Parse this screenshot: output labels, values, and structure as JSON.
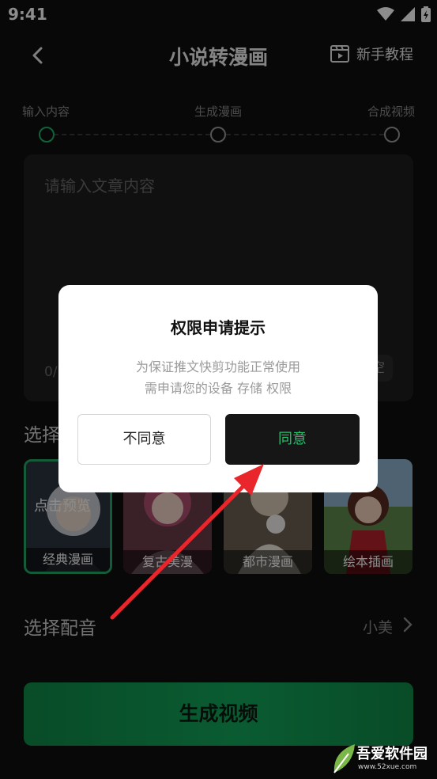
{
  "status_bar": {
    "time": "9:41"
  },
  "nav": {
    "title": "小说转漫画",
    "tutorial_label": "新手教程"
  },
  "steps": [
    {
      "label": "输入内容",
      "active": true
    },
    {
      "label": "生成漫画",
      "active": false
    },
    {
      "label": "合成视频",
      "active": false
    }
  ],
  "input": {
    "placeholder": "请输入文章内容",
    "count": "0/",
    "clear_label": "空"
  },
  "styles_section": {
    "title": "选择",
    "preview_tip": "点击预览",
    "items": [
      {
        "label": "经典漫画",
        "selected": true
      },
      {
        "label": "复古美漫",
        "selected": false
      },
      {
        "label": "都市漫画",
        "selected": false
      },
      {
        "label": "绘本插画",
        "selected": false
      }
    ]
  },
  "voice": {
    "label": "选择配音",
    "value": "小美"
  },
  "generate": {
    "label": "生成视频"
  },
  "dialog": {
    "title": "权限申请提示",
    "message_line1": "为保证推文快剪功能正常使用",
    "message_line2": "需申请您的设备 存储 权限",
    "cancel_label": "不同意",
    "ok_label": "同意"
  },
  "watermark": {
    "text": "吾爱软件园",
    "url": "www.52xue.com"
  },
  "colors": {
    "accent": "#1db36a",
    "dialog_ok_text": "#25c26e",
    "arrow": "#e8262c"
  }
}
